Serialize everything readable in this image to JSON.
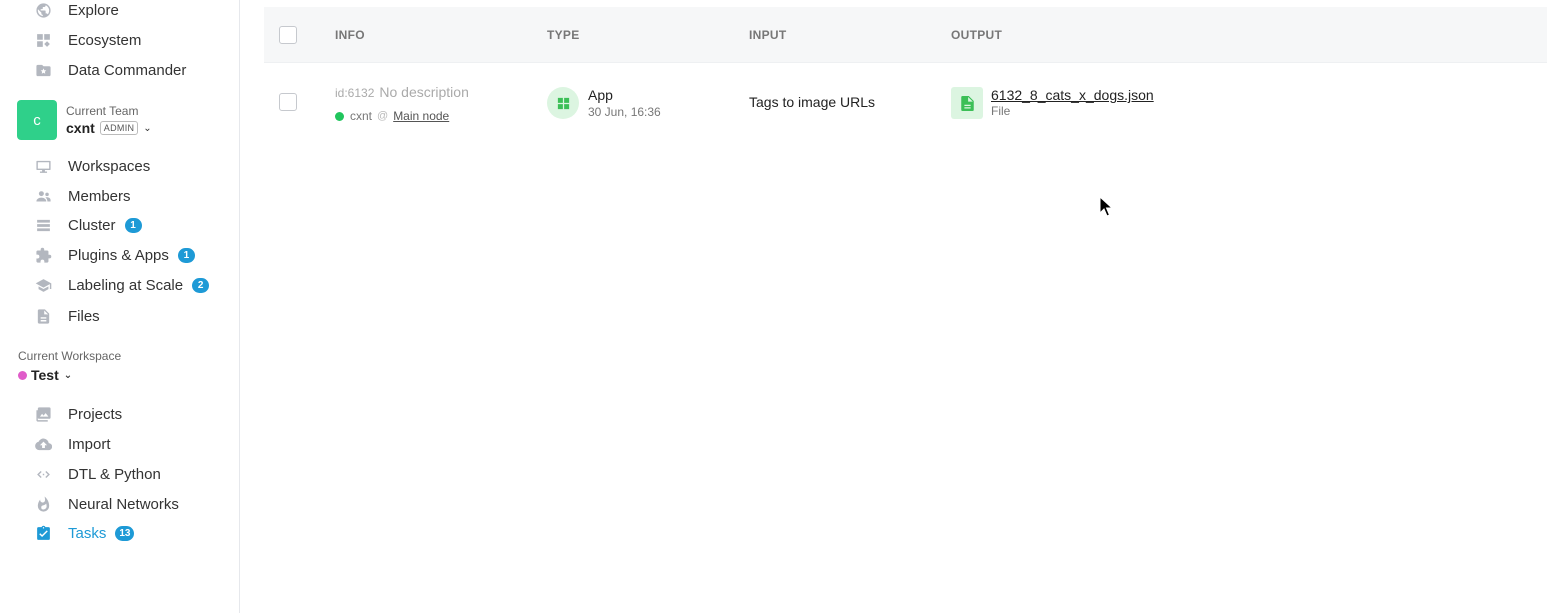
{
  "sidebar": {
    "top_items": [
      {
        "label": "Explore",
        "icon": "globe-icon"
      },
      {
        "label": "Ecosystem",
        "icon": "ecosystem-icon"
      },
      {
        "label": "Data Commander",
        "icon": "folder-star-icon"
      }
    ],
    "team": {
      "avatar_letter": "c",
      "label": "Current Team",
      "name": "cxnt",
      "role": "ADMIN",
      "avatar_color": "#2fd08a"
    },
    "team_items": [
      {
        "label": "Workspaces",
        "icon": "monitor-icon",
        "badge": ""
      },
      {
        "label": "Members",
        "icon": "members-icon",
        "badge": ""
      },
      {
        "label": "Cluster",
        "icon": "cluster-icon",
        "badge": "1"
      },
      {
        "label": "Plugins & Apps",
        "icon": "puzzle-icon",
        "badge": "1"
      },
      {
        "label": "Labeling at Scale",
        "icon": "graduation-cap-icon",
        "badge": "2"
      },
      {
        "label": "Files",
        "icon": "file-icon",
        "badge": ""
      }
    ],
    "workspace": {
      "label": "Current Workspace",
      "name": "Test",
      "dot_color": "#e05cc9"
    },
    "workspace_items": [
      {
        "label": "Projects",
        "icon": "images-icon",
        "badge": ""
      },
      {
        "label": "Import",
        "icon": "cloud-upload-icon",
        "badge": ""
      },
      {
        "label": "DTL & Python",
        "icon": "code-icon",
        "badge": ""
      },
      {
        "label": "Neural Networks",
        "icon": "flame-icon",
        "badge": ""
      },
      {
        "label": "Tasks",
        "icon": "clipboard-check-icon",
        "badge": "13",
        "active": true
      }
    ],
    "accent_color": "#1e9ad6"
  },
  "table": {
    "headers": {
      "info": "INFO",
      "type": "TYPE",
      "input": "INPUT",
      "output": "OUTPUT"
    },
    "rows": [
      {
        "id": "id:6132",
        "description": "No description",
        "user": "cxnt",
        "at": "@",
        "node": "Main node",
        "type": "App",
        "date": "30 Jun, 16:36",
        "input": "Tags to image URLs",
        "output_name": "6132_8_cats_x_dogs.json",
        "output_type": "File"
      }
    ]
  }
}
